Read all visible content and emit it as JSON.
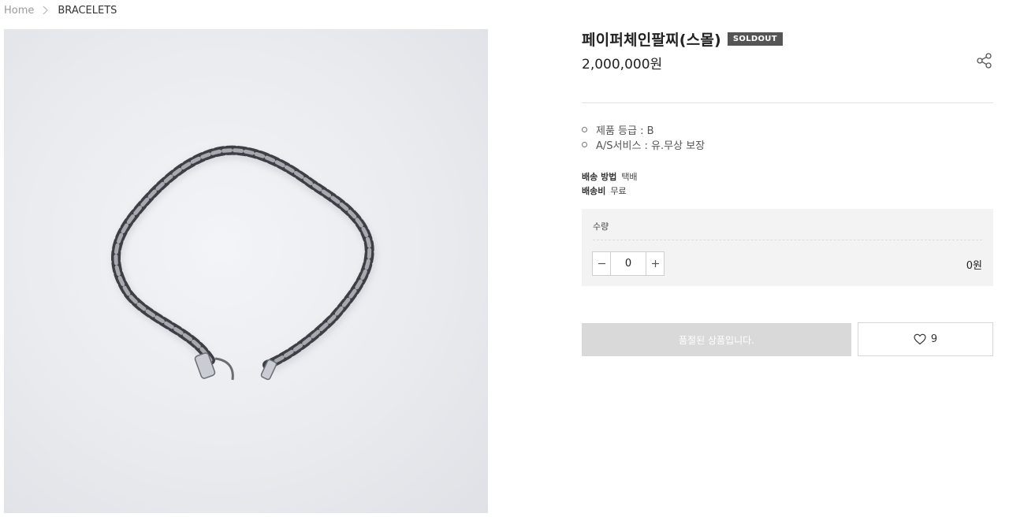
{
  "breadcrumb": {
    "home": "Home",
    "separator_icon": "chevron-right-icon",
    "current": "BRACELETS"
  },
  "product": {
    "title": "페이퍼체인팔찌(스몰)",
    "badge": "SOLDOUT",
    "price": "2,000,000원",
    "image_alt": "silver paper chain bracelet"
  },
  "share": {
    "icon": "share-icon"
  },
  "info": [
    {
      "label": "제품 등급 : B"
    },
    {
      "label": "A/S서비스 :  유.무상 보장"
    }
  ],
  "shipping": {
    "method_label": "배송 방법",
    "method_value": "택배",
    "fee_label": "배송비",
    "fee_value": "무료"
  },
  "quantity": {
    "label": "수량",
    "value": "0",
    "minus_icon": "minus-icon",
    "plus_icon": "plus-icon",
    "total": "0원"
  },
  "actions": {
    "soldout_label": "품절된 상품입니다.",
    "wish_icon": "heart-icon",
    "wish_count": "9"
  },
  "colors": {
    "badge_bg": "#555555",
    "soldout_button_bg": "#d9d9d9",
    "option_panel_bg": "#f3f3f3"
  }
}
